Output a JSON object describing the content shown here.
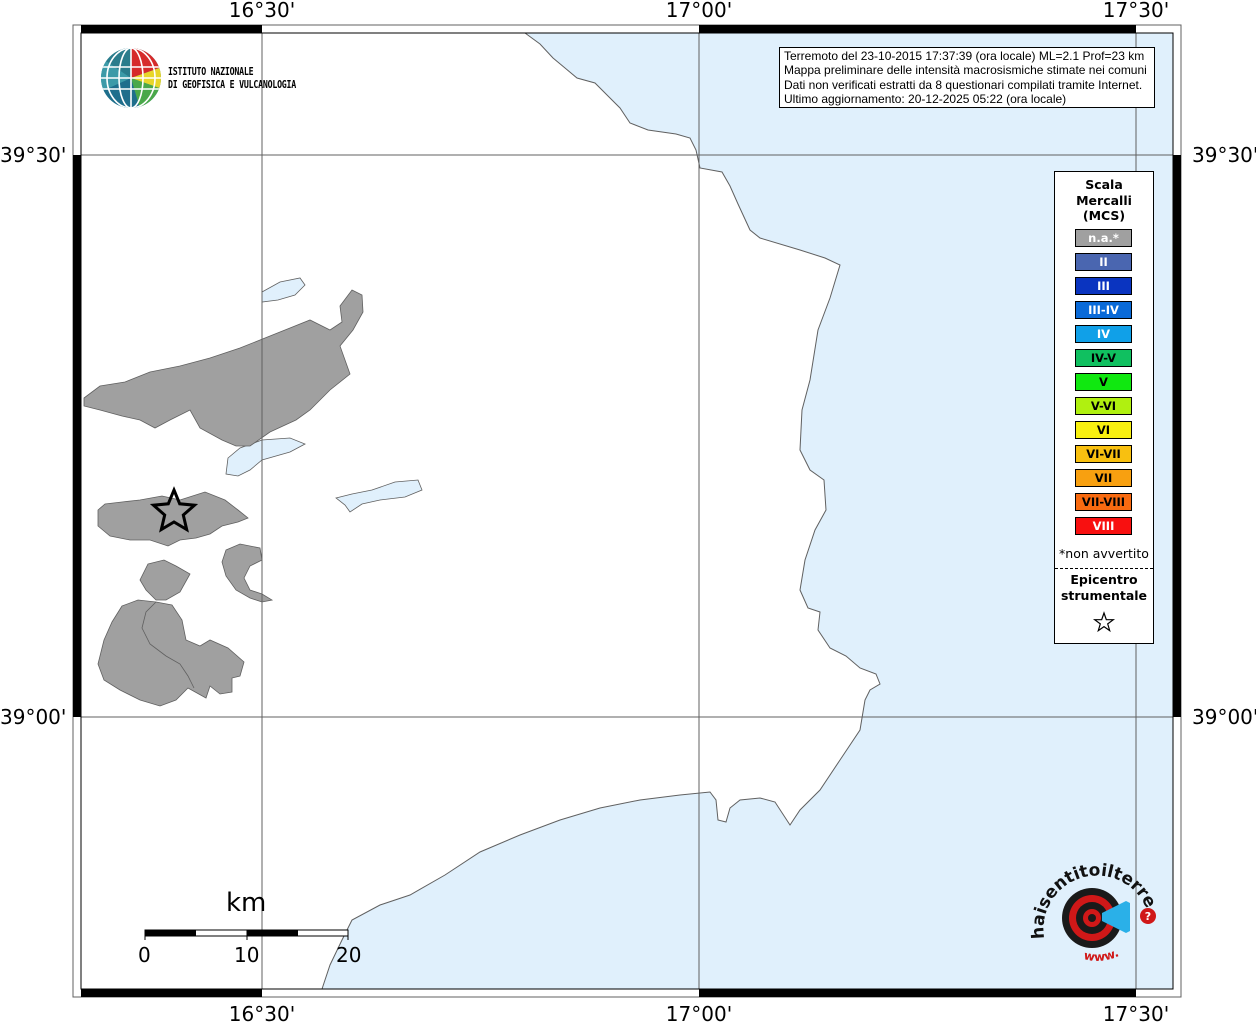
{
  "grid_labels": {
    "top": [
      "16°30'",
      "17°00'",
      "17°30'"
    ],
    "bottom": [
      "16°30'",
      "17°00'",
      "17°30'"
    ],
    "left": [
      "39°30'",
      "39°00'"
    ],
    "right": [
      "39°30'",
      "39°00'"
    ]
  },
  "info": {
    "line1": "Terremoto del 23-10-2015 17:37:39 (ora locale) ML=2.1 Prof=23 km",
    "line2": "Mappa preliminare delle intensità macrosismiche stimate nei comuni",
    "line3": "Dati non verificati estratti da 8 questionari compilati tramite Internet.",
    "line4": "Ultimo aggiornamento: 20-12-2025 05:22 (ora locale)"
  },
  "logo": {
    "line1": "ISTITUTO NAZIONALE",
    "line2": "DI GEOFISICA E VULCANOLOGIA"
  },
  "legend": {
    "title_line1": "Scala",
    "title_line2": "Mercalli",
    "title_line3": "(MCS)",
    "items": [
      {
        "label": "n.a.*",
        "color": "#a0a0a0",
        "text_color": "#ffffff"
      },
      {
        "label": "II",
        "color": "#4a66b0",
        "text_color": "#ffffff"
      },
      {
        "label": "III",
        "color": "#0a34c0",
        "text_color": "#ffffff"
      },
      {
        "label": "III-IV",
        "color": "#0a6ad8",
        "text_color": "#ffffff"
      },
      {
        "label": "IV",
        "color": "#10a0e8",
        "text_color": "#ffffff"
      },
      {
        "label": "IV-V",
        "color": "#10c060",
        "text_color": "#000000"
      },
      {
        "label": "V",
        "color": "#10e810",
        "text_color": "#000000"
      },
      {
        "label": "V-VI",
        "color": "#b0f010",
        "text_color": "#000000"
      },
      {
        "label": "VI",
        "color": "#f8f010",
        "text_color": "#000000"
      },
      {
        "label": "VI-VII",
        "color": "#f8c010",
        "text_color": "#000000"
      },
      {
        "label": "VII",
        "color": "#f8a010",
        "text_color": "#000000"
      },
      {
        "label": "VII-VIII",
        "color": "#f86a10",
        "text_color": "#000000"
      },
      {
        "label": "VIII",
        "color": "#f81010",
        "text_color": "#ffffff"
      }
    ],
    "note": "*non avvertito",
    "epicenter_line1": "Epicentro",
    "epicenter_line2": "strumentale"
  },
  "scale_bar": {
    "unit": "km",
    "labels": [
      "0",
      "10",
      "20"
    ]
  },
  "colors": {
    "sea": "#e0f0fc",
    "land": "#ffffff",
    "municipality": "#a0a0a0",
    "coast": "#606060"
  },
  "hst_logo": {
    "text": "haisentitoilterremoto.it",
    "prefix": "www."
  }
}
